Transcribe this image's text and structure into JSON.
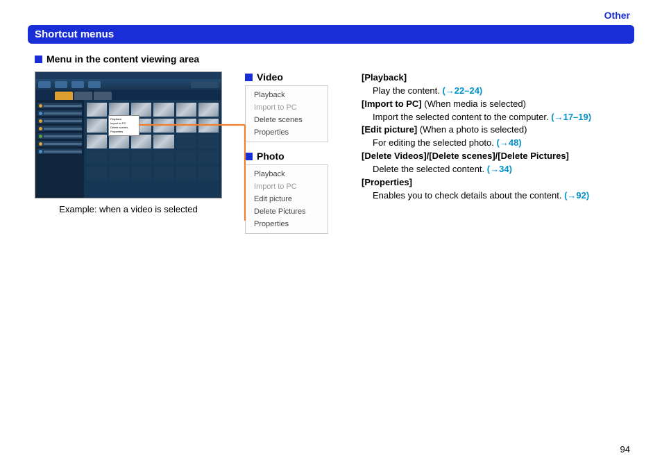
{
  "header": {
    "category": "Other",
    "title": "Shortcut menus"
  },
  "section_heading": "Menu in the content viewing area",
  "caption": "Example: when a video is selected",
  "menus": {
    "video": {
      "label": "Video",
      "items": [
        "Playback",
        "Import to PC",
        "Delete scenes",
        "Properties"
      ]
    },
    "photo": {
      "label": "Photo",
      "items": [
        "Playback",
        "Import to PC",
        "Edit picture",
        "Delete Pictures",
        "Properties"
      ]
    }
  },
  "popup_items": [
    "Playback",
    "Import to PC",
    "Delete scenes",
    "Properties"
  ],
  "descriptions": [
    {
      "term": "[Playback]",
      "note": "",
      "body": "Play the content. ",
      "ref": "(→22–24)"
    },
    {
      "term": "[Import to PC]",
      "note": " (When media is selected)",
      "body": "Import the selected content to the computer. ",
      "ref": "(→17–19)"
    },
    {
      "term": "[Edit picture]",
      "note": " (When a photo is selected)",
      "body": "For editing the selected photo. ",
      "ref": "(→48)"
    },
    {
      "term": "[Delete Videos]/[Delete scenes]/[Delete Pictures]",
      "note": "",
      "body": "Delete the selected content. ",
      "ref": "(→34)"
    },
    {
      "term": "[Properties]",
      "note": "",
      "body": "Enables you to check details about the content. ",
      "ref": "(→92)"
    }
  ],
  "page_number": "94"
}
